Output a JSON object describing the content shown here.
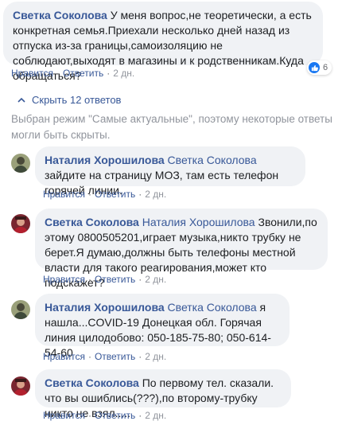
{
  "comment": {
    "author": "Светка Соколова",
    "text": " У меня вопрос,не теоретически, а есть конкретная семья.Приехали несколько дней назад из отпуска из-за границы,самоизоляцию не соблюдают,выходят в магазины и к родственникам.Куда обращаться?",
    "like_label": "Нравится",
    "reply_label": "Ответить",
    "time": "2 дн.",
    "reactions_count": "6"
  },
  "replies_toggle": {
    "label": "Скрыть 12 ответов"
  },
  "notice": "Выбран режим \"Самые актуальные\", поэтому некоторые ответы могли быть скрыты.",
  "replies": [
    {
      "author": "Наталия Хорошилова",
      "mention": "Светка Соколова",
      "text": " зайдите на страницу МОЗ, там есть телефон горячей линии.",
      "like_label": "Нравится",
      "reply_label": "Ответить",
      "time": "2 дн."
    },
    {
      "author": "Светка Соколова",
      "mention": "Наталия Хорошилова",
      "text": " Звонили,по этому 0800505201,играет музыка,никто трубку не берет.Я думаю,должны быть телефоны местной власти для такого реагирования,может кто подскажет?",
      "like_label": "Нравится",
      "reply_label": "Ответить",
      "time": "2 дн."
    },
    {
      "author": "Наталия Хорошилова",
      "mention": "Светка Соколова",
      "text": " я нашла...COVID-19 Донецкая обл. Горячая линия цилодобово: 050-185-75-80; 050-614-54-60",
      "like_label": "Нравится",
      "reply_label": "Ответить",
      "time": "2 дн."
    },
    {
      "author": "Светка Соколова",
      "mention": "",
      "text": " По первому тел. сказали. что вы ошиблись(???),по второму-трубку никто не взял.....",
      "like_label": "Нравится",
      "reply_label": "Ответить",
      "time": "2 дн."
    }
  ],
  "colors": {
    "link": "#385898",
    "bubble": "#f0f2f5",
    "meta": "#90949c",
    "like_blue": "#1877f2"
  }
}
